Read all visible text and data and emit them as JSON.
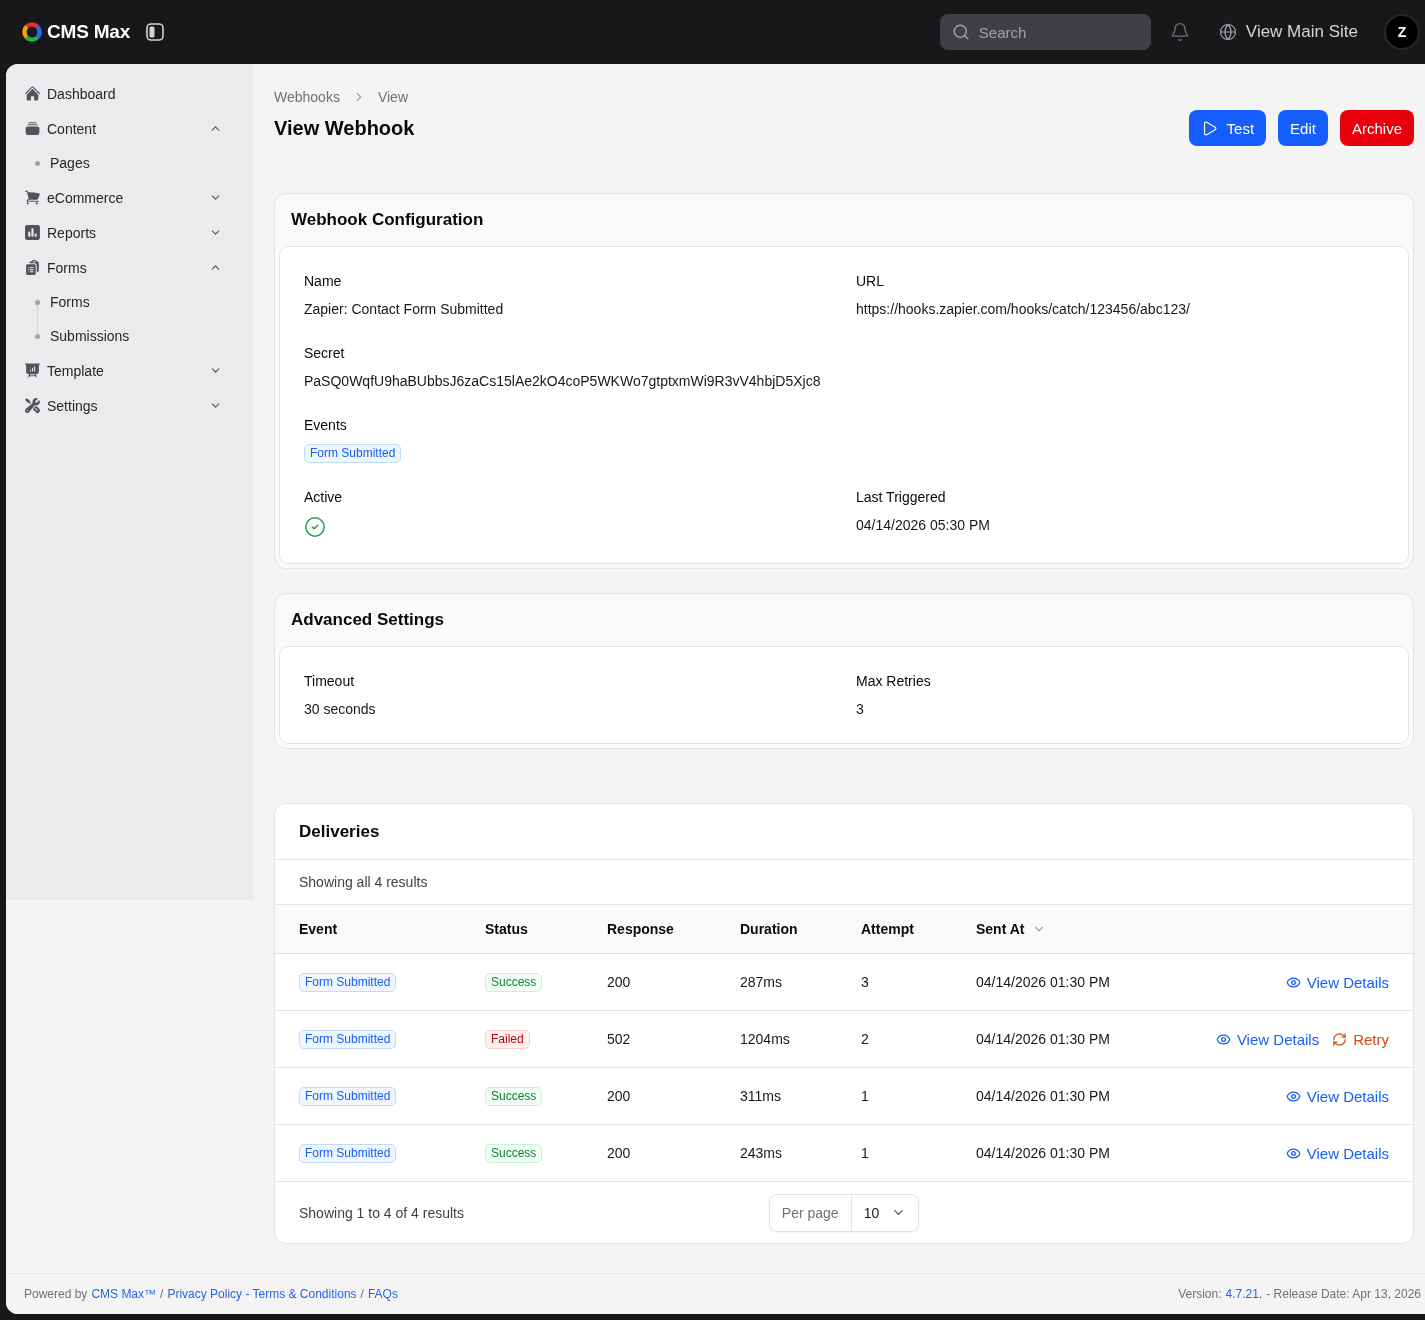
{
  "topbar": {
    "brand": "CMS Max",
    "search": {
      "placeholder": "Search"
    },
    "view_site": "View Main Site",
    "avatar": "Z"
  },
  "sidebar": {
    "items": [
      {
        "label": "Dashboard"
      },
      {
        "label": "Content",
        "expanded": true,
        "children": [
          {
            "label": "Pages"
          }
        ]
      },
      {
        "label": "eCommerce",
        "expanded": false
      },
      {
        "label": "Reports",
        "expanded": false
      },
      {
        "label": "Forms",
        "expanded": true,
        "children": [
          {
            "label": "Forms"
          },
          {
            "label": "Submissions"
          }
        ]
      },
      {
        "label": "Template",
        "expanded": false
      },
      {
        "label": "Settings",
        "expanded": false
      }
    ]
  },
  "breadcrumbs": [
    "Webhooks",
    "View"
  ],
  "title": "View Webhook",
  "actions": [
    {
      "label": "Test",
      "kind": "run"
    },
    {
      "label": "Edit",
      "kind": "primary"
    },
    {
      "label": "Archive",
      "kind": "danger"
    }
  ],
  "sections": [
    {
      "title": "Webhook Configuration",
      "fields": [
        {
          "label": "Name",
          "kind": "text",
          "value": "Zapier: Contact Form Submitted"
        },
        {
          "label": "URL",
          "kind": "text",
          "value": "https://hooks.zapier.com/hooks/catch/123456/abc123/"
        },
        {
          "label": "Secret",
          "kind": "text",
          "value": "PaSQ0WqfU9haBUbbsJ6zaCs15lAe2kO4coP5WKWo7gtptxmWi9R3vV4hbjD5Xjc8",
          "wide": true
        },
        {
          "label": "Events",
          "kind": "tags",
          "tags": [
            "Form Submitted"
          ],
          "wide": true
        },
        {
          "label": "Active",
          "kind": "boolean",
          "on": true
        },
        {
          "label": "Last Triggered",
          "kind": "text",
          "value": "04/14/2026 05:30 PM"
        }
      ]
    },
    {
      "title": "Advanced Settings",
      "fields": [
        {
          "label": "Timeout",
          "kind": "text",
          "value": "30 seconds"
        },
        {
          "label": "Max Retries",
          "kind": "text",
          "value": "3"
        }
      ]
    }
  ],
  "deliveries": {
    "title": "Deliveries",
    "summary": "Showing all 4 results",
    "columns": [
      {
        "label": "Event"
      },
      {
        "label": "Status"
      },
      {
        "label": "Response"
      },
      {
        "label": "Duration"
      },
      {
        "label": "Attempt"
      },
      {
        "label": "Sent At",
        "sorted": true
      }
    ],
    "rows": [
      {
        "event": "Form Submitted",
        "status": {
          "label": "Success",
          "kind": "success"
        },
        "response": "200",
        "duration": "287ms",
        "attempt": "3",
        "sent_at": "04/14/2026 01:30 PM",
        "actions": [
          {
            "kind": "view",
            "label": "View Details"
          }
        ]
      },
      {
        "event": "Form Submitted",
        "status": {
          "label": "Failed",
          "kind": "failed"
        },
        "response": "502",
        "duration": "1204ms",
        "attempt": "2",
        "sent_at": "04/14/2026 01:30 PM",
        "actions": [
          {
            "kind": "view",
            "label": "View Details"
          },
          {
            "kind": "retry",
            "label": "Retry"
          }
        ]
      },
      {
        "event": "Form Submitted",
        "status": {
          "label": "Success",
          "kind": "success"
        },
        "response": "200",
        "duration": "311ms",
        "attempt": "1",
        "sent_at": "04/14/2026 01:30 PM",
        "actions": [
          {
            "kind": "view",
            "label": "View Details"
          }
        ]
      },
      {
        "event": "Form Submitted",
        "status": {
          "label": "Success",
          "kind": "success"
        },
        "response": "200",
        "duration": "243ms",
        "attempt": "1",
        "sent_at": "04/14/2026 01:30 PM",
        "actions": [
          {
            "kind": "view",
            "label": "View Details"
          }
        ]
      }
    ],
    "pagination": {
      "summary": "Showing 1 to 4 of 4 results",
      "per_page_label": "Per page",
      "per_page": "10"
    }
  },
  "footer": {
    "left": [
      {
        "kind": "text",
        "text": "Powered by"
      },
      {
        "kind": "link",
        "text": "CMS Max™"
      },
      {
        "kind": "text",
        "text": "/"
      },
      {
        "kind": "link",
        "text": "Privacy Policy - Terms & Conditions"
      },
      {
        "kind": "text",
        "text": "/"
      },
      {
        "kind": "link",
        "text": "FAQs"
      }
    ],
    "right": [
      {
        "kind": "text",
        "text": "Version:"
      },
      {
        "kind": "link",
        "text": "4.7.21."
      },
      {
        "kind": "text",
        "text": "- Release Date: Apr 13, 2026"
      }
    ]
  }
}
